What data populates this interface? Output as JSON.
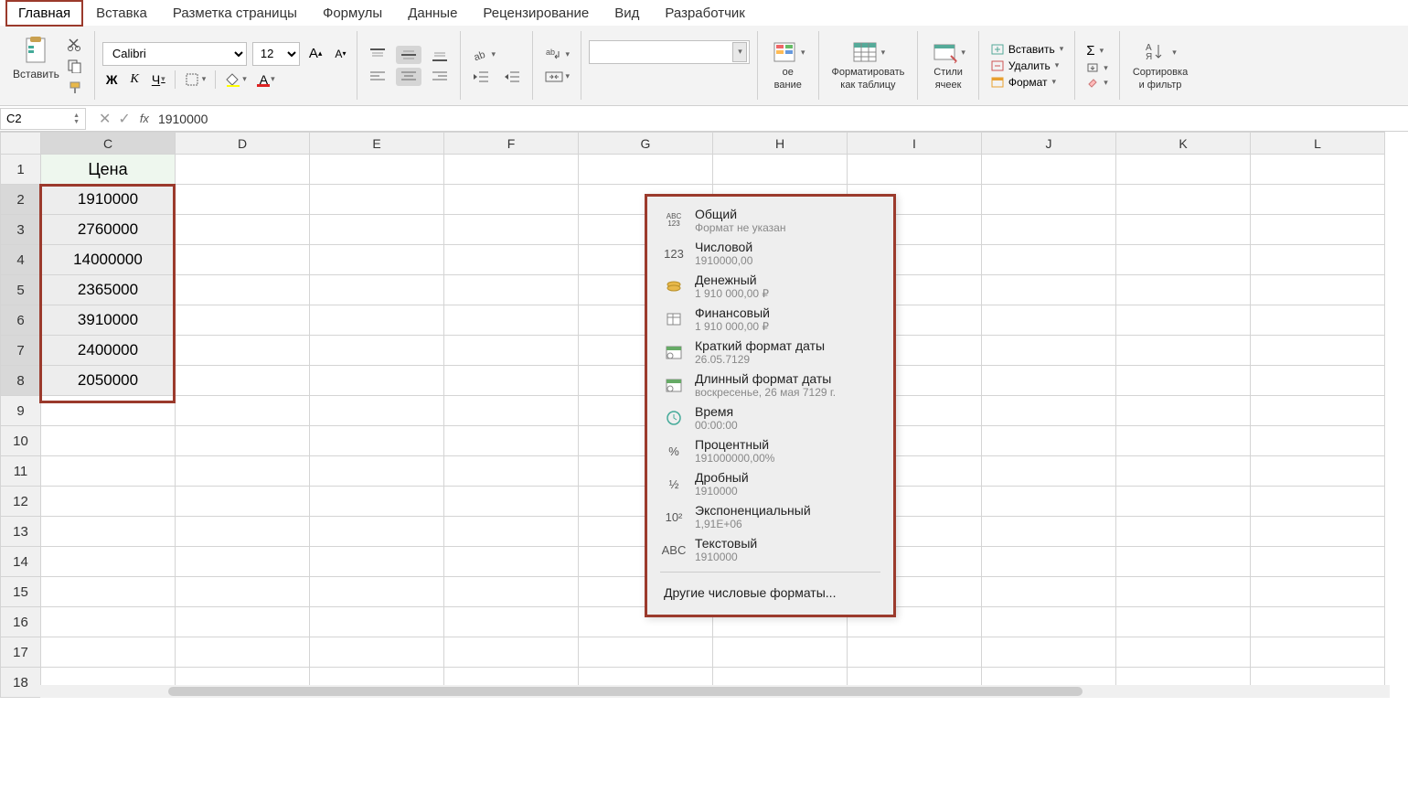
{
  "tabs": [
    "Главная",
    "Вставка",
    "Разметка страницы",
    "Формулы",
    "Данные",
    "Рецензирование",
    "Вид",
    "Разработчик"
  ],
  "active_tab": 0,
  "ribbon": {
    "paste_label": "Вставить",
    "font_name": "Calibri",
    "font_size": "12",
    "cond_fmt": "ое\nвание",
    "fmt_table": "Форматировать\nкак таблицу",
    "styles": "Стили\nячеек",
    "insert": "Вставить",
    "delete": "Удалить",
    "format": "Формат",
    "sort": "Сортировка\nи фильтр"
  },
  "name_box": "C2",
  "formula_value": "1910000",
  "columns": [
    "C",
    "D",
    "E",
    "F",
    "G",
    "H",
    "I",
    "J",
    "K",
    "L"
  ],
  "row_count": 18,
  "selected_first": 2,
  "selected_last": 8,
  "cells": {
    "C1": "Цена",
    "C2": "1910000",
    "C3": "2760000",
    "C4": "14000000",
    "C5": "2365000",
    "C6": "3910000",
    "C7": "2400000",
    "C8": "2050000"
  },
  "format_menu": {
    "items": [
      {
        "icon": "ABC\n123",
        "title": "Общий",
        "sub": "Формат не указан"
      },
      {
        "icon": "123",
        "title": "Числовой",
        "sub": "1910000,00"
      },
      {
        "icon": "coins",
        "title": "Денежный",
        "sub": "1 910 000,00 ₽"
      },
      {
        "icon": "ledger",
        "title": "Финансовый",
        "sub": "1 910 000,00 ₽"
      },
      {
        "icon": "cal",
        "title": "Краткий формат даты",
        "sub": "26.05.7129"
      },
      {
        "icon": "cal",
        "title": "Длинный формат даты",
        "sub": "воскресенье, 26 мая 7129 г."
      },
      {
        "icon": "clock",
        "title": "Время",
        "sub": "00:00:00"
      },
      {
        "icon": "%",
        "title": "Процентный",
        "sub": "191000000,00%"
      },
      {
        "icon": "½",
        "title": "Дробный",
        "sub": "1910000"
      },
      {
        "icon": "10²",
        "title": "Экспоненциальный",
        "sub": "1,91E+06"
      },
      {
        "icon": "ABC",
        "title": "Текстовый",
        "sub": "1910000"
      }
    ],
    "more": "Другие числовые форматы..."
  }
}
